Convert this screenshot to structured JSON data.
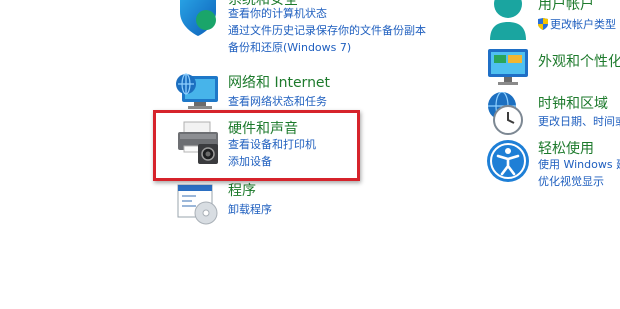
{
  "left_column": [
    {
      "id": "system-security",
      "title": "系统和安全",
      "icon": "shield-icon",
      "links": [
        "查看你的计算机状态",
        "通过文件历史记录保存你的文件备份副本",
        "备份和还原(Windows 7)"
      ]
    },
    {
      "id": "network",
      "title": "网络和 Internet",
      "icon": "network-globe-icon",
      "links": [
        "查看网络状态和任务"
      ]
    },
    {
      "id": "hardware-sound",
      "title": "硬件和声音",
      "icon": "printer-icon",
      "links": [
        "查看设备和打印机",
        "添加设备"
      ]
    },
    {
      "id": "programs",
      "title": "程序",
      "icon": "programs-disc-icon",
      "links": [
        "卸载程序"
      ]
    }
  ],
  "right_column": [
    {
      "id": "user-accounts",
      "title": "用户帐户",
      "icon": "user-icon",
      "links": [
        "更改帐户类型"
      ]
    },
    {
      "id": "appearance",
      "title": "外观和个性化",
      "icon": "monitor-icon",
      "links": []
    },
    {
      "id": "clock-region",
      "title": "时钟和区域",
      "icon": "clock-globe-icon",
      "links": [
        "更改日期、时间或"
      ]
    },
    {
      "id": "ease-of-access",
      "title": "轻松使用",
      "icon": "accessibility-icon",
      "links": [
        "使用 Windows 建",
        "优化视觉显示"
      ]
    }
  ],
  "colors": {
    "category_title": "#1d7a2c",
    "link": "#1f5fbf",
    "highlight_border": "#d6232b"
  }
}
